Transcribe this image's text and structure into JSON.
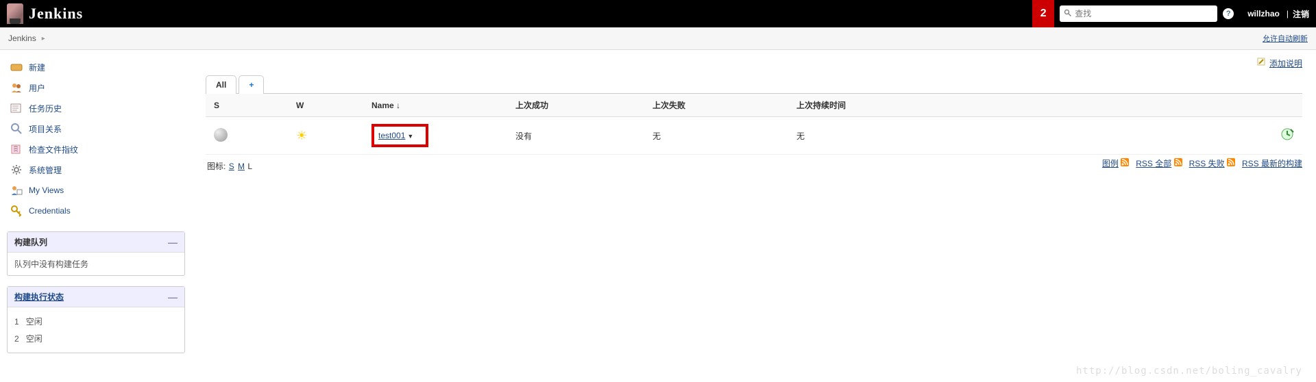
{
  "header": {
    "logo_text": "Jenkins",
    "notification_count": "2",
    "search_placeholder": "查找",
    "username": "willzhao",
    "logout": "注销"
  },
  "breadcrumb": {
    "root": "Jenkins",
    "auto_refresh": "允许自动刷新"
  },
  "sidebar": {
    "items": [
      {
        "label": "新建"
      },
      {
        "label": "用户"
      },
      {
        "label": "任务历史"
      },
      {
        "label": "项目关系"
      },
      {
        "label": "检查文件指纹"
      },
      {
        "label": "系统管理"
      },
      {
        "label": "My Views"
      },
      {
        "label": "Credentials"
      }
    ],
    "build_queue": {
      "title": "构建队列",
      "empty": "队列中没有构建任务"
    },
    "executor": {
      "title": "构建执行状态",
      "rows": [
        {
          "num": "1",
          "state": "空闲"
        },
        {
          "num": "2",
          "state": "空闲"
        }
      ]
    }
  },
  "content": {
    "add_description": "添加说明",
    "tabs": {
      "all": "All",
      "add": "+"
    },
    "columns": {
      "s": "S",
      "w": "W",
      "name": "Name  ↓",
      "last_success": "上次成功",
      "last_failure": "上次失败",
      "last_duration": "上次持续时间"
    },
    "rows": [
      {
        "name": "test001",
        "last_success": "没有",
        "last_failure": "无",
        "last_duration": "无"
      }
    ],
    "icon_label": "图标:",
    "icon_sizes": {
      "s": "S",
      "m": "M",
      "l": "L"
    },
    "legend": "图例",
    "rss_all": "RSS 全部",
    "rss_fail": "RSS 失败",
    "rss_latest": "RSS 最新的构建"
  },
  "watermark": "http://blog.csdn.net/boling_cavalry"
}
